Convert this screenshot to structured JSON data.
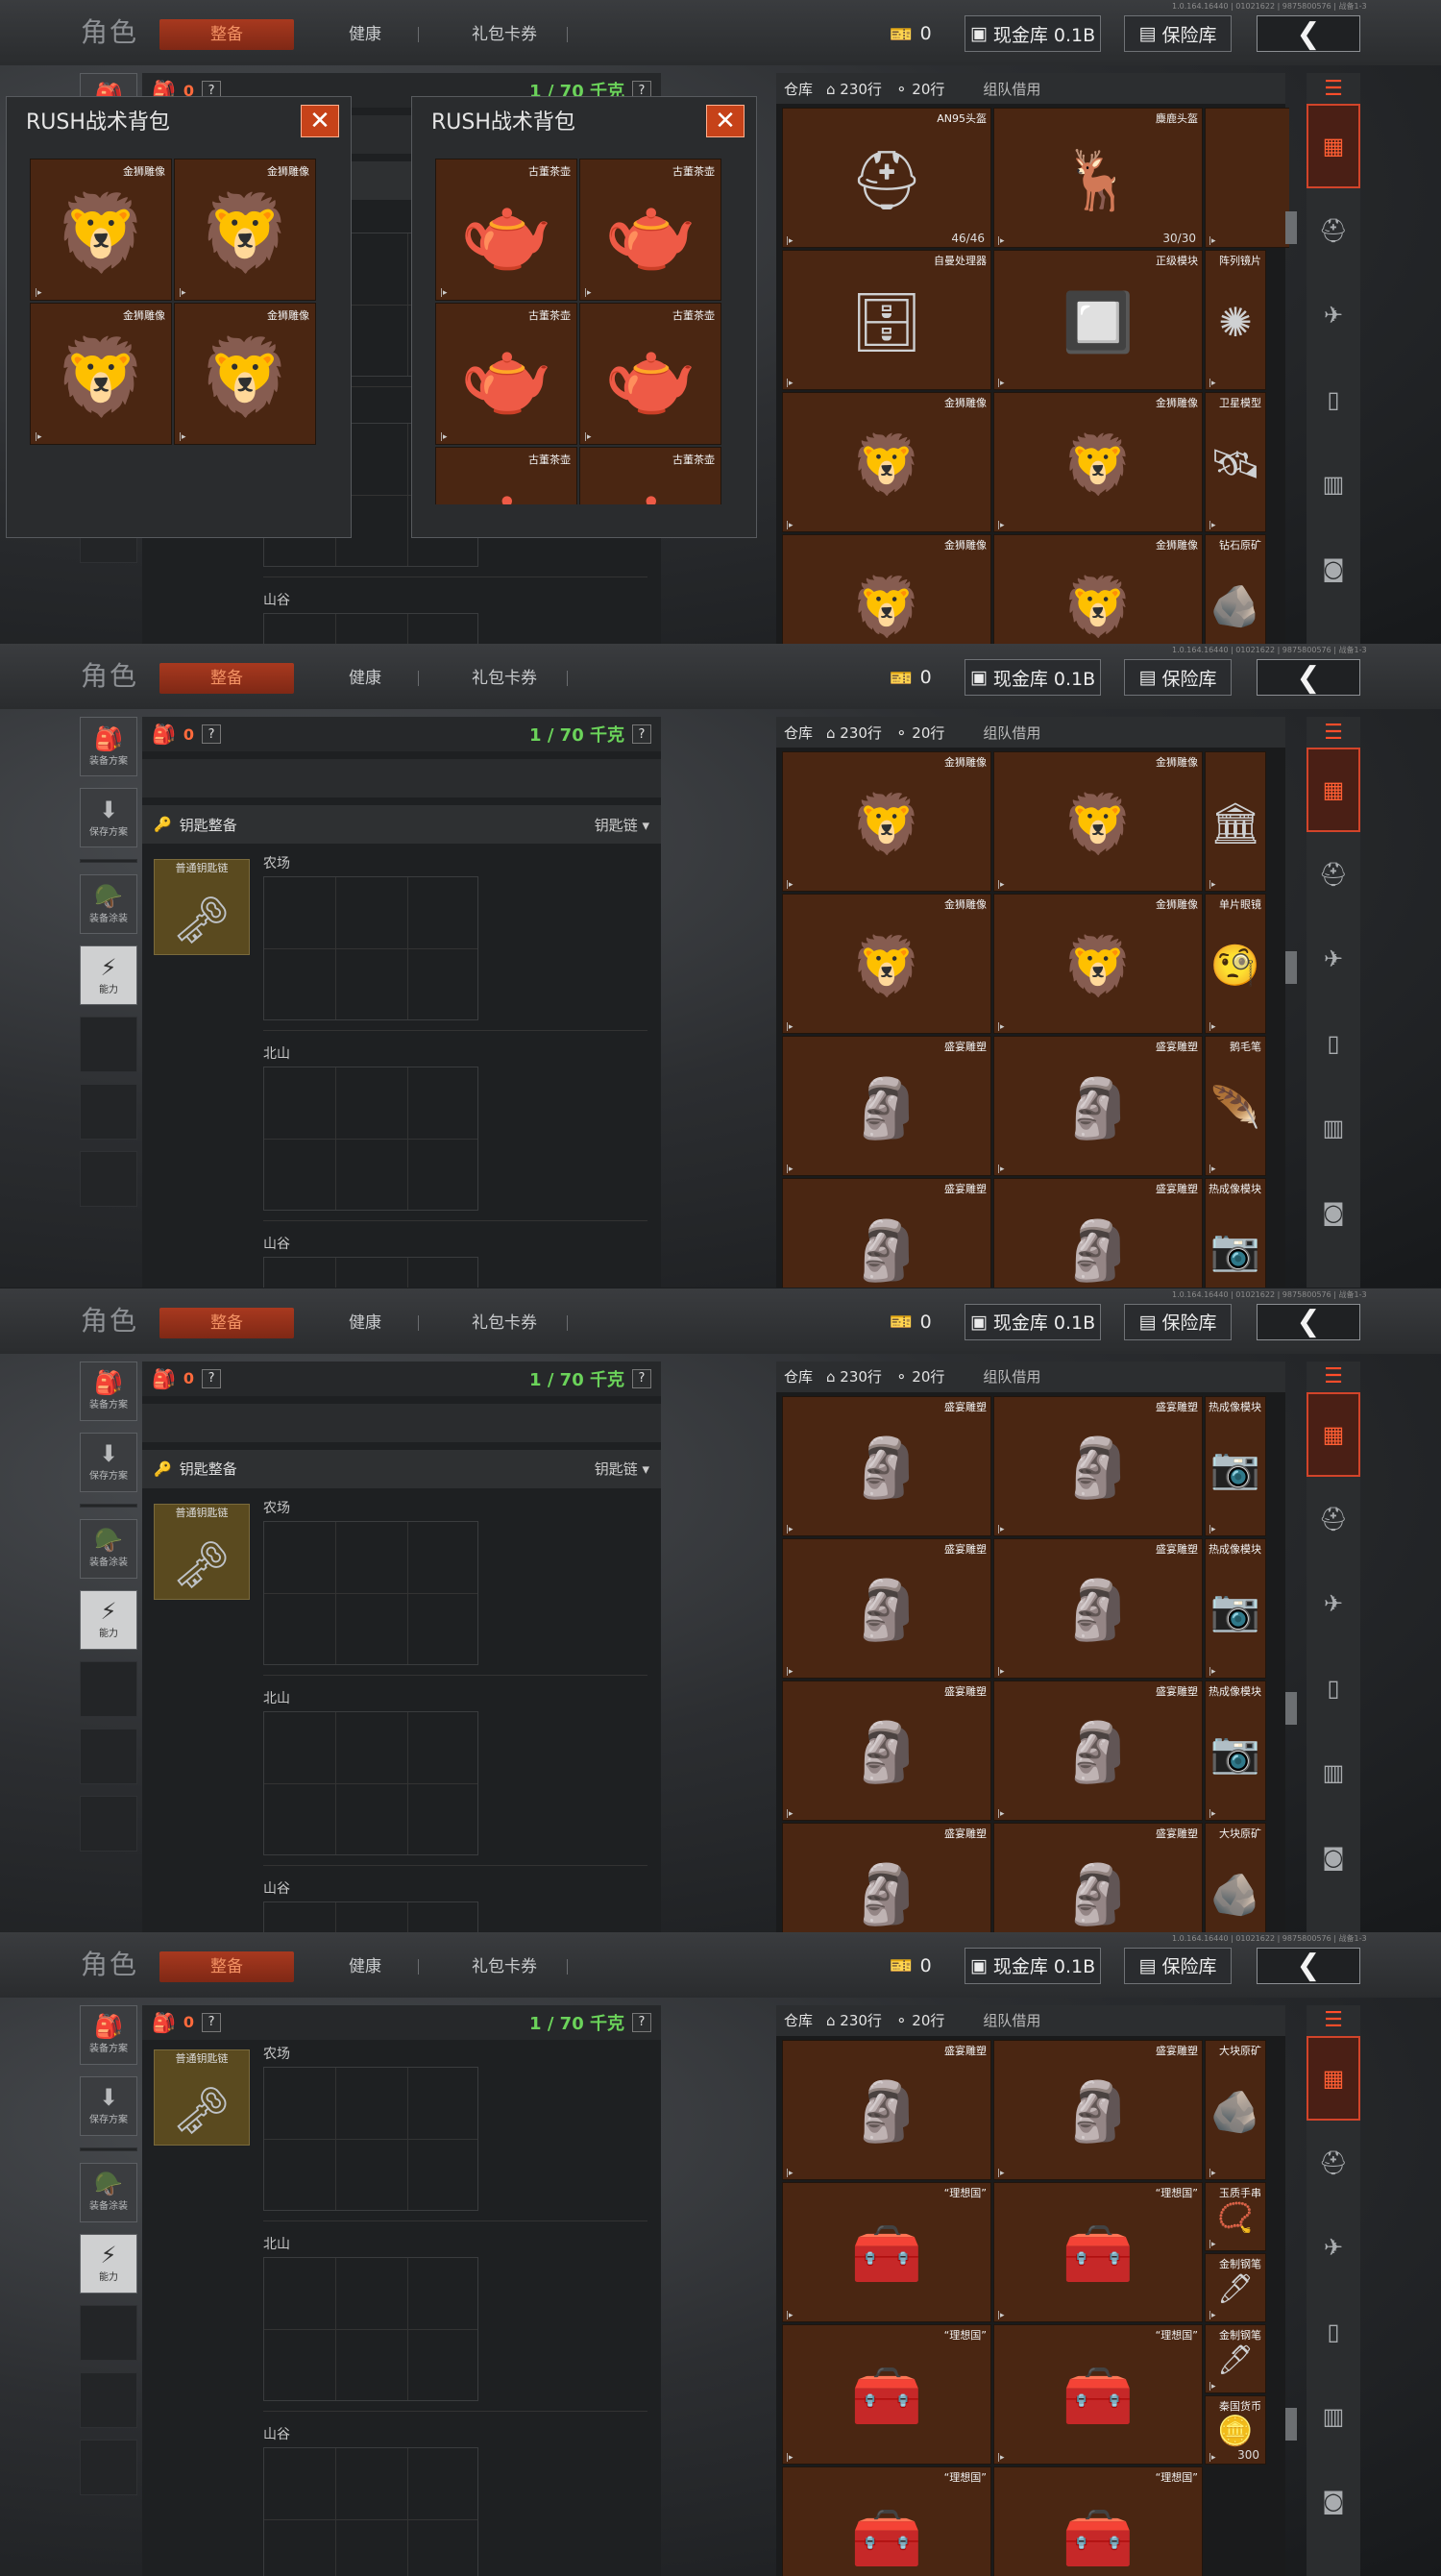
{
  "title": "角色",
  "tabs": [
    "整备",
    "健康",
    "礼包卡券"
  ],
  "version": "1.0.164.16440 | 01021622 | 9875800576 | 战备1-3",
  "currency_count": "0",
  "cash_label": "现金库 0.1B",
  "safe_label": "保险库",
  "back_icon": "chevron-left-icon",
  "left_rail": {
    "plan_label": "装备方案",
    "save_label": "保存方案",
    "paint_label": "装备涂装",
    "power_label": "能力"
  },
  "equip": {
    "bag_count": "0",
    "help": "?",
    "weight": "1 / 70 千克",
    "key_section": "钥匙整备",
    "keychain_type": "钥匙链",
    "keychain_name": "普通钥匙链",
    "zones": [
      "农场",
      "北山",
      "山谷"
    ]
  },
  "warehouse": {
    "label": "仓库",
    "rows": "230行",
    "cols": "20行",
    "team": "组队借用"
  },
  "popups": [
    {
      "title": "RUSH战术背包",
      "items": [
        "金狮雕像",
        "金狮雕像",
        "金狮雕像",
        "金狮雕像"
      ],
      "icon": "🦁"
    },
    {
      "title": "RUSH战术背包",
      "items": [
        "古董茶壶",
        "古董茶壶",
        "古董茶壶",
        "古董茶壶",
        "古董茶壶",
        "古董茶壶"
      ],
      "icon": "🫖"
    }
  ],
  "item_names": {
    "AN95": "AN95头盔",
    "elk": "麋鹿头盔",
    "proc": "自曼处理器",
    "server": "正级模块",
    "array": "阵列镜片",
    "lion": "金狮雕像",
    "sat": "卫星模型",
    "ore": "钻石原矿",
    "tower": "",
    "mono": "单片眼镜",
    "bust": "盛宴雕塑",
    "quill": "鹅毛笔",
    "therm": "热成像模块",
    "bigore": "大块原矿",
    "utopia": "“理想国”",
    "bracelet": "玉质手串",
    "pen": "金制钢笔",
    "coin": "秦国货币"
  },
  "item_counts": {
    "AN95": "46/46",
    "elk": "30/30",
    "coin": "300"
  },
  "screens": [
    {
      "id": "screen-1",
      "show_popups": true,
      "scroll": 0.2,
      "grid": [
        {
          "key": "AN95",
          "col": 0,
          "row": 0,
          "w": 1,
          "h": 1,
          "icon": "⛑"
        },
        {
          "key": "elk",
          "col": 1,
          "row": 0,
          "w": 1,
          "h": 1,
          "icon": "🦌"
        },
        {
          "key": "proc",
          "col": 2,
          "row": 0,
          "w": 1.3,
          "h": 1,
          "icon": "🗄"
        },
        {
          "key": "proc",
          "col": 0,
          "row": 1,
          "w": 1,
          "h": 1,
          "icon": "🗄"
        },
        {
          "key": "server",
          "col": 1,
          "row": 1,
          "w": 1,
          "h": 1,
          "icon": "🔲"
        },
        {
          "key": "array",
          "col": 2,
          "row": 1,
          "w": 0.3,
          "h": 1,
          "icon": "✺"
        },
        {
          "key": "lion",
          "col": 0,
          "row": 2,
          "w": 1,
          "h": 1,
          "icon": "🦁"
        },
        {
          "key": "lion",
          "col": 1,
          "row": 2,
          "w": 1,
          "h": 1,
          "icon": "🦁"
        },
        {
          "key": "sat",
          "col": 2,
          "row": 2,
          "w": 0.3,
          "h": 1,
          "icon": "🛰"
        },
        {
          "key": "lion",
          "col": 0,
          "row": 3,
          "w": 1,
          "h": 1,
          "icon": "🦁"
        },
        {
          "key": "lion",
          "col": 1,
          "row": 3,
          "w": 1,
          "h": 1,
          "icon": "🦁"
        },
        {
          "key": "ore",
          "col": 2,
          "row": 3,
          "w": 0.3,
          "h": 1,
          "icon": "🪨"
        }
      ]
    },
    {
      "id": "screen-2",
      "show_popups": false,
      "scroll": 0.4,
      "grid": [
        {
          "key": "lion",
          "col": 0,
          "row": 0,
          "w": 1,
          "h": 1,
          "icon": "🦁"
        },
        {
          "key": "lion",
          "col": 1,
          "row": 0,
          "w": 1,
          "h": 1,
          "icon": "🦁"
        },
        {
          "key": "tower",
          "col": 2,
          "row": 0,
          "w": 0.3,
          "h": 1,
          "icon": "🏛"
        },
        {
          "key": "lion",
          "col": 0,
          "row": 1,
          "w": 1,
          "h": 1,
          "icon": "🦁"
        },
        {
          "key": "lion",
          "col": 1,
          "row": 1,
          "w": 1,
          "h": 1,
          "icon": "🦁"
        },
        {
          "key": "mono",
          "col": 2,
          "row": 1,
          "w": 0.3,
          "h": 1,
          "icon": "🧐"
        },
        {
          "key": "bust",
          "col": 0,
          "row": 2,
          "w": 1,
          "h": 1,
          "icon": "🗿"
        },
        {
          "key": "bust",
          "col": 1,
          "row": 2,
          "w": 1,
          "h": 1,
          "icon": "🗿"
        },
        {
          "key": "quill",
          "col": 2,
          "row": 2,
          "w": 0.3,
          "h": 1,
          "icon": "🪶"
        },
        {
          "key": "bust",
          "col": 0,
          "row": 3,
          "w": 1,
          "h": 1,
          "icon": "🗿"
        },
        {
          "key": "bust",
          "col": 1,
          "row": 3,
          "w": 1,
          "h": 1,
          "icon": "🗿"
        },
        {
          "key": "therm",
          "col": 2,
          "row": 3,
          "w": 0.3,
          "h": 1,
          "icon": "📷"
        }
      ]
    },
    {
      "id": "screen-3",
      "show_popups": false,
      "scroll": 0.6,
      "grid": [
        {
          "key": "bust",
          "col": 0,
          "row": 0,
          "w": 1,
          "h": 1,
          "icon": "🗿"
        },
        {
          "key": "bust",
          "col": 1,
          "row": 0,
          "w": 1,
          "h": 1,
          "icon": "🗿"
        },
        {
          "key": "therm",
          "col": 2,
          "row": 0,
          "w": 0.3,
          "h": 1,
          "icon": "📷"
        },
        {
          "key": "bust",
          "col": 0,
          "row": 1,
          "w": 1,
          "h": 1,
          "icon": "🗿"
        },
        {
          "key": "bust",
          "col": 1,
          "row": 1,
          "w": 1,
          "h": 1,
          "icon": "🗿"
        },
        {
          "key": "therm",
          "col": 2,
          "row": 1,
          "w": 0.3,
          "h": 1,
          "icon": "📷"
        },
        {
          "key": "bust",
          "col": 0,
          "row": 2,
          "w": 1,
          "h": 1,
          "icon": "🗿"
        },
        {
          "key": "bust",
          "col": 1,
          "row": 2,
          "w": 1,
          "h": 1,
          "icon": "🗿"
        },
        {
          "key": "therm",
          "col": 2,
          "row": 2,
          "w": 0.3,
          "h": 1,
          "icon": "📷"
        },
        {
          "key": "bust",
          "col": 0,
          "row": 3,
          "w": 1,
          "h": 1,
          "icon": "🗿"
        },
        {
          "key": "bust",
          "col": 1,
          "row": 3,
          "w": 1,
          "h": 1,
          "icon": "🗿"
        },
        {
          "key": "bigore",
          "col": 2,
          "row": 3,
          "w": 0.3,
          "h": 1,
          "icon": "🪨"
        }
      ]
    },
    {
      "id": "screen-4",
      "show_popups": false,
      "scroll": 0.75,
      "grid": [
        {
          "key": "bust",
          "col": 0,
          "row": 0,
          "w": 1,
          "h": 1,
          "icon": "🗿"
        },
        {
          "key": "bust",
          "col": 1,
          "row": 0,
          "w": 1,
          "h": 1,
          "icon": "🗿"
        },
        {
          "key": "bigore",
          "col": 2,
          "row": 0,
          "w": 0.3,
          "h": 1,
          "icon": "🪨"
        },
        {
          "key": "utopia",
          "col": 0,
          "row": 1,
          "w": 1,
          "h": 1,
          "icon": "🧰"
        },
        {
          "key": "utopia",
          "col": 1,
          "row": 1,
          "w": 1,
          "h": 1,
          "icon": "🧰"
        },
        {
          "key": "bracelet",
          "col": 2,
          "row": 1,
          "w": 0.3,
          "h": 0.5,
          "icon": "📿"
        },
        {
          "key": "pen",
          "col": 2,
          "row": 1.5,
          "w": 0.3,
          "h": 0.5,
          "icon": "🖊"
        },
        {
          "key": "utopia",
          "col": 0,
          "row": 2,
          "w": 1,
          "h": 1,
          "icon": "🧰"
        },
        {
          "key": "utopia",
          "col": 1,
          "row": 2,
          "w": 1,
          "h": 1,
          "icon": "🧰"
        },
        {
          "key": "pen",
          "col": 2,
          "row": 2,
          "w": 0.3,
          "h": 0.5,
          "icon": "🖊"
        },
        {
          "key": "coin",
          "col": 2,
          "row": 2.5,
          "w": 0.3,
          "h": 0.5,
          "icon": "🪙"
        },
        {
          "key": "utopia",
          "col": 0,
          "row": 3,
          "w": 1,
          "h": 1,
          "icon": "🧰"
        },
        {
          "key": "utopia",
          "col": 1,
          "row": 3,
          "w": 1,
          "h": 1,
          "icon": "🧰"
        }
      ]
    }
  ]
}
